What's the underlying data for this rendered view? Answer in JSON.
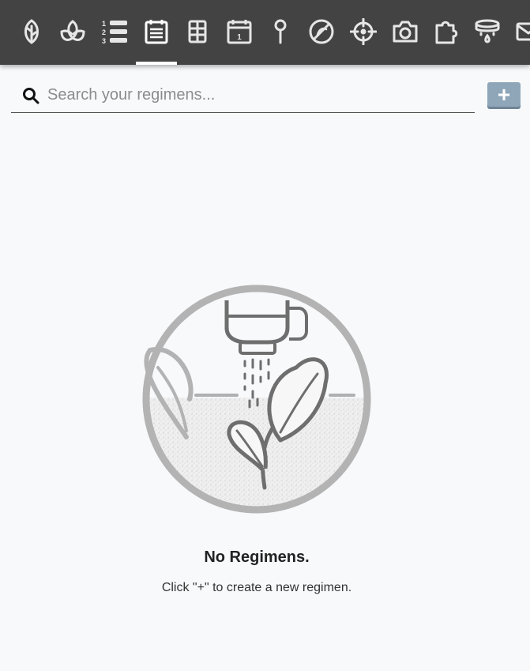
{
  "nav": {
    "tabs": [
      {
        "name": "plants-icon"
      },
      {
        "name": "groups-icon"
      },
      {
        "name": "sequences-icon"
      },
      {
        "name": "regimens-icon",
        "active": true
      },
      {
        "name": "farmware-icon"
      },
      {
        "name": "events-icon"
      },
      {
        "name": "point-icon"
      },
      {
        "name": "weeds-icon"
      },
      {
        "name": "controls-icon"
      },
      {
        "name": "photos-icon"
      },
      {
        "name": "plugins-icon"
      },
      {
        "name": "tools-icon"
      },
      {
        "name": "messages-icon"
      }
    ]
  },
  "search": {
    "placeholder": "Search your regimens...",
    "value": ""
  },
  "add_button": {
    "label": "+"
  },
  "empty_state": {
    "title": "No Regimens.",
    "description": "Click \"+\" to create a new regimen."
  },
  "colors": {
    "topbar": "#434343",
    "background": "#f7f9fb",
    "add_button": "#8fa6b8",
    "illustration_gray": "#b3b3b3"
  }
}
